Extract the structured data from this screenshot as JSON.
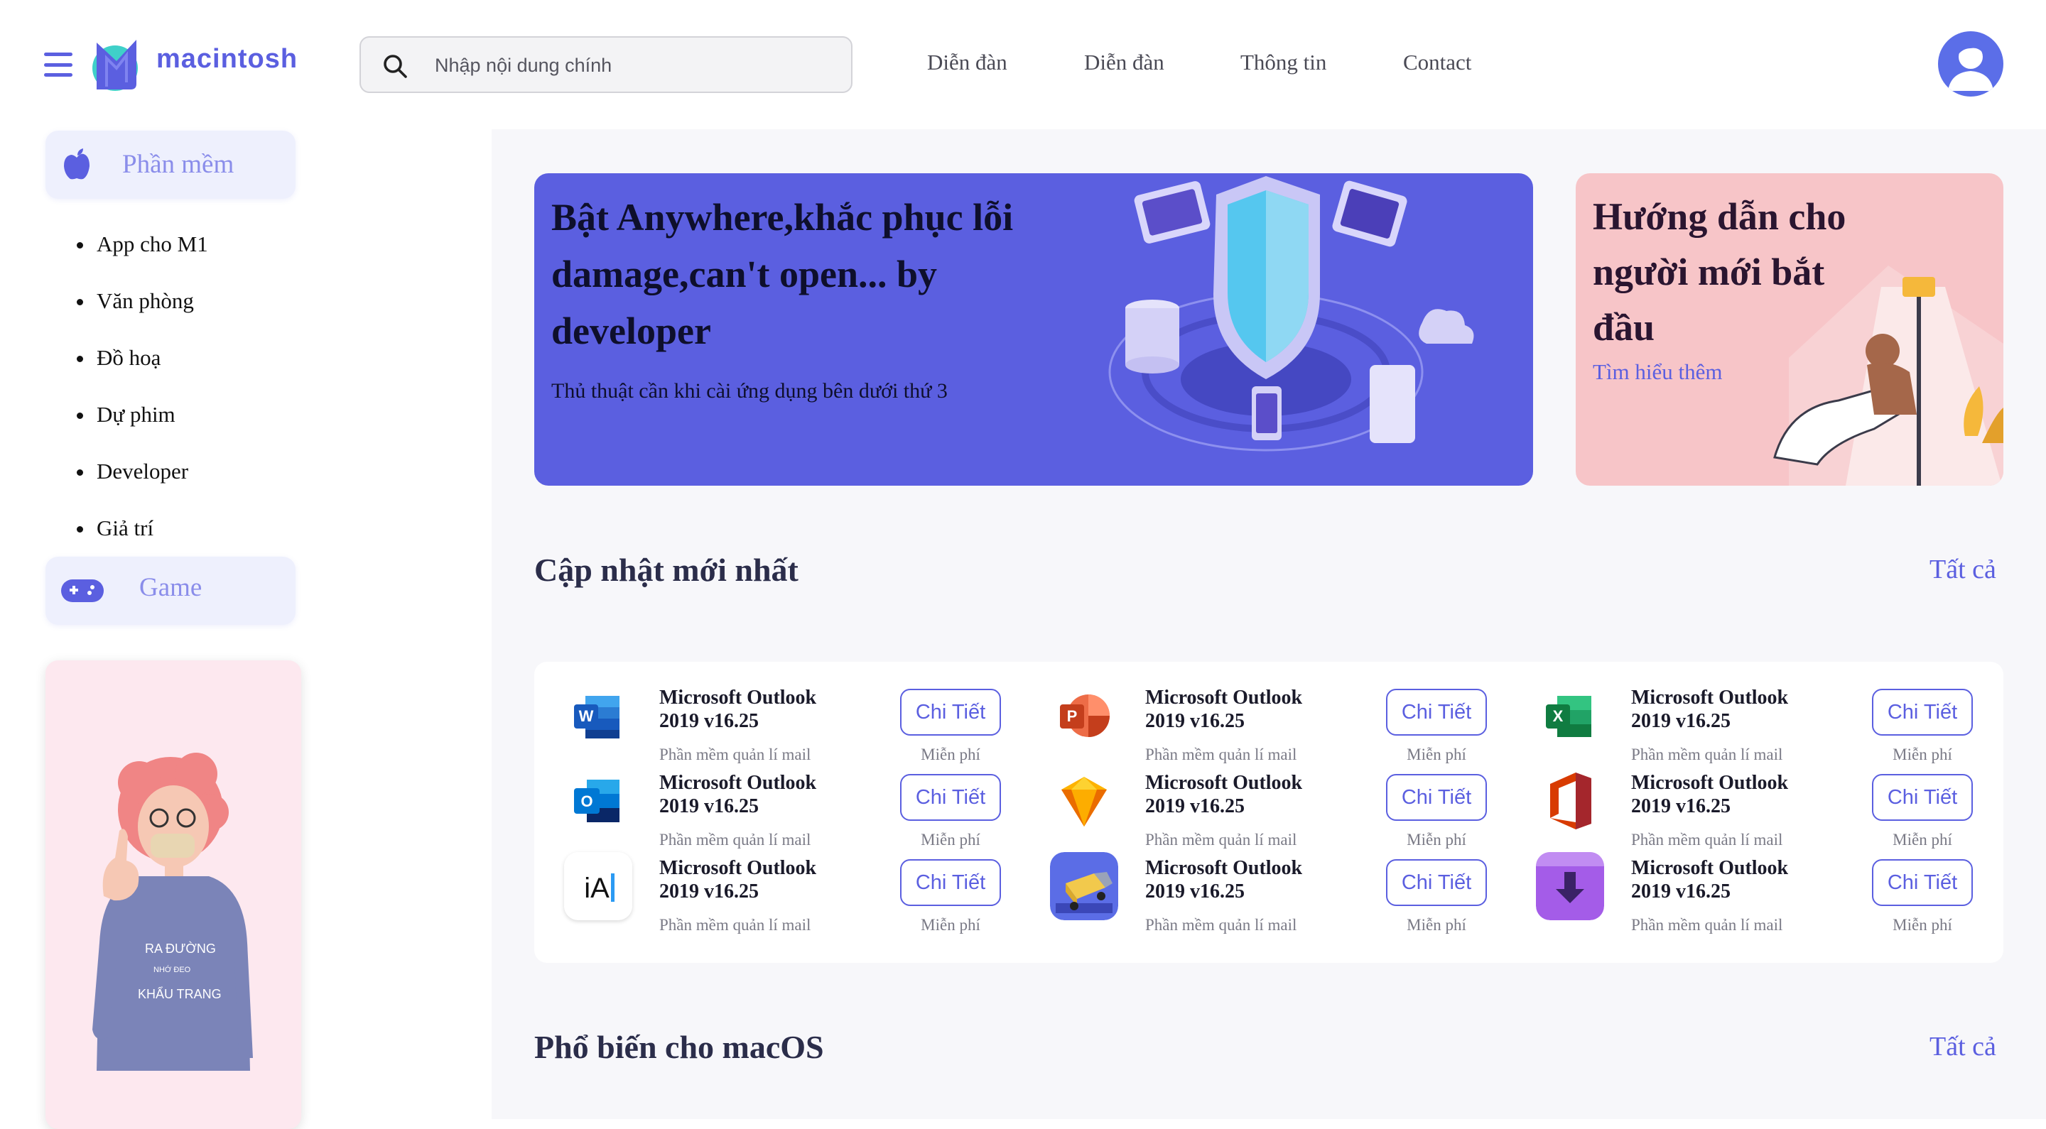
{
  "header": {
    "logo_text": "macintosh",
    "search_placeholder": "Nhập nội dung chính",
    "nav": [
      "Diễn đàn",
      "Diễn đàn",
      "Thông tin",
      "Contact"
    ]
  },
  "sidebar": {
    "software_label": "Phần mềm",
    "subcategories": [
      "App cho M1",
      "Văn phòng",
      "Đồ hoạ",
      "Dự phim",
      "Developer",
      "Giả trí"
    ],
    "game_label": "Game",
    "promo_text": [
      "RA ĐƯỜNG",
      "NHỚ ĐEO",
      "KHẨU TRANG"
    ]
  },
  "hero": {
    "title": "Bật Anywhere,khắc phục lỗi damage,can't open... by developer",
    "subtitle": "Thủ thuật cần khi cài ứng dụng bên dưới thứ 3"
  },
  "guide": {
    "title": "Hướng dẫn cho người mới bắt đầu",
    "link": "Tìm hiểu thêm"
  },
  "latest": {
    "title": "Cập nhật mới nhất",
    "see_all": "Tất cả",
    "apps": [
      {
        "icon": "word-icon",
        "name": "Microsoft Outlook 2019 v16.25",
        "desc": "Phần mềm quản lí mail",
        "button": "Chi Tiết",
        "price": "Miễn phí"
      },
      {
        "icon": "powerpoint-icon",
        "name": "Microsoft Outlook 2019 v16.25",
        "desc": "Phần mềm quản lí mail",
        "button": "Chi Tiết",
        "price": "Miễn phí"
      },
      {
        "icon": "excel-icon",
        "name": "Microsoft Outlook 2019 v16.25",
        "desc": "Phần mềm quản lí mail",
        "button": "Chi Tiết",
        "price": "Miễn phí"
      },
      {
        "icon": "outlook-icon",
        "name": "Microsoft Outlook 2019 v16.25",
        "desc": "Phần mềm quản lí mail",
        "button": "Chi Tiết",
        "price": "Miễn phí"
      },
      {
        "icon": "sketch-icon",
        "name": "Microsoft Outlook 2019 v16.25",
        "desc": "Phần mềm quản lí mail",
        "button": "Chi Tiết",
        "price": "Miễn phí"
      },
      {
        "icon": "office-icon",
        "name": "Microsoft Outlook 2019 v16.25",
        "desc": "Phần mềm quản lí mail",
        "button": "Chi Tiết",
        "price": "Miễn phí"
      },
      {
        "icon": "ia-writer-icon",
        "name": "Microsoft Outlook 2019 v16.25",
        "desc": "Phần mềm quản lí mail",
        "button": "Chi Tiết",
        "price": "Miễn phí"
      },
      {
        "icon": "transmit-truck-icon",
        "name": "Microsoft Outlook 2019 v16.25",
        "desc": "Phần mềm quản lí mail",
        "button": "Chi Tiết",
        "price": "Miễn phí"
      },
      {
        "icon": "downie-icon",
        "name": "Microsoft Outlook 2019 v16.25",
        "desc": "Phần mềm quản lí mail",
        "button": "Chi Tiết",
        "price": "Miễn phí"
      }
    ]
  },
  "popular": {
    "title": "Phổ biến cho macOS",
    "see_all": "Tất cả"
  },
  "colors": {
    "accent": "#5b5fe0",
    "hero_bg": "#5b5fe0",
    "guide_bg": "#f7c5c8",
    "main_bg": "#f7f7fa",
    "category_bg": "#eef0fd"
  }
}
